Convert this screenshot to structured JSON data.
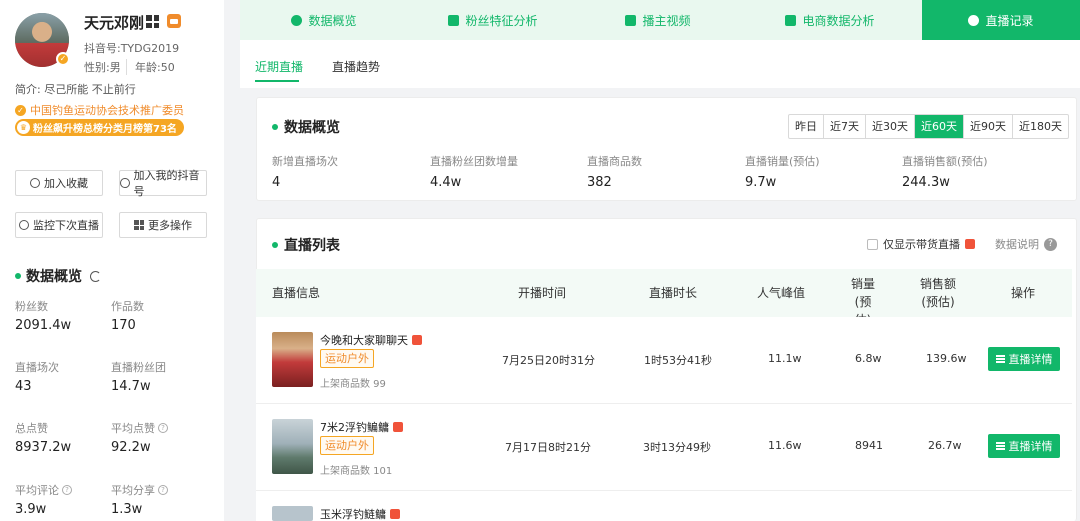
{
  "profile": {
    "name": "天元邓刚",
    "douyin_id": "抖音号:TYDG2019",
    "gender": "性别:男",
    "age": "年龄:50",
    "bio": "简介: 尽己所能 不止前行",
    "certification": "中国钓鱼运动协会技术推广委员",
    "rank": "粉丝飙升榜总榜分类月榜第73名"
  },
  "sidebar_buttons": {
    "favorite": "加入收藏",
    "add_to_mine": "加入我的抖音号",
    "monitor": "监控下次直播",
    "more": "更多操作"
  },
  "sidebar_overview": {
    "title": "数据概览",
    "stats": [
      {
        "label": "粉丝数",
        "value": "2091.4w"
      },
      {
        "label": "作品数",
        "value": "170"
      },
      {
        "label": "直播场次",
        "value": "43"
      },
      {
        "label": "直播粉丝团",
        "value": "14.7w"
      },
      {
        "label": "总点赞",
        "value": "8937.2w"
      },
      {
        "label": "平均点赞",
        "value": "92.2w"
      },
      {
        "label": "平均评论",
        "value": "3.9w"
      },
      {
        "label": "平均分享",
        "value": "1.3w"
      }
    ]
  },
  "tabs": [
    "数据概览",
    "粉丝特征分析",
    "播主视频",
    "电商数据分析",
    "直播记录"
  ],
  "active_tab": "直播记录",
  "subtabs": [
    "近期直播",
    "直播趋势"
  ],
  "overview": {
    "title": "数据概览",
    "ranges": [
      "昨日",
      "近7天",
      "近30天",
      "近60天",
      "近90天",
      "近180天"
    ],
    "active_range": "近60天",
    "metrics": [
      {
        "label": "新增直播场次",
        "value": "4"
      },
      {
        "label": "直播粉丝团数增量",
        "value": "4.4w"
      },
      {
        "label": "直播商品数",
        "value": "382"
      },
      {
        "label": "直播销量(预估)",
        "value": "9.7w"
      },
      {
        "label": "直播销售额(预估)",
        "value": "244.3w"
      }
    ]
  },
  "live_list": {
    "title": "直播列表",
    "only_goods": "仅显示带货直播",
    "explain": "数据说明",
    "headers": {
      "info": "直播信息",
      "start": "开播时间",
      "duration": "直播时长",
      "peak": "人气峰值",
      "sales_1": "销量",
      "sales_2": "(预估)",
      "revenue_1": "销售额",
      "revenue_2": "(预估)",
      "action": "操作"
    },
    "rows": [
      {
        "title": "今晚和大家聊聊天",
        "tag": "运动户外",
        "goods": "上架商品数 99",
        "start": "7月25日20时31分",
        "duration": "1时53分41秒",
        "peak": "11.1w",
        "sales": "6.8w",
        "revenue": "139.6w",
        "button": "直播详情"
      },
      {
        "title": "7米2浮钓鳊鳙",
        "tag": "运动户外",
        "goods": "上架商品数 101",
        "start": "7月17日8时21分",
        "duration": "3时13分49秒",
        "peak": "11.6w",
        "sales": "8941",
        "revenue": "26.7w",
        "button": "直播详情"
      },
      {
        "title": "玉米浮钓鲢鳙"
      }
    ]
  },
  "colors": {
    "accent": "#12b76a",
    "orange": "#f5a623",
    "tab_bg": "#e9f8ef"
  }
}
